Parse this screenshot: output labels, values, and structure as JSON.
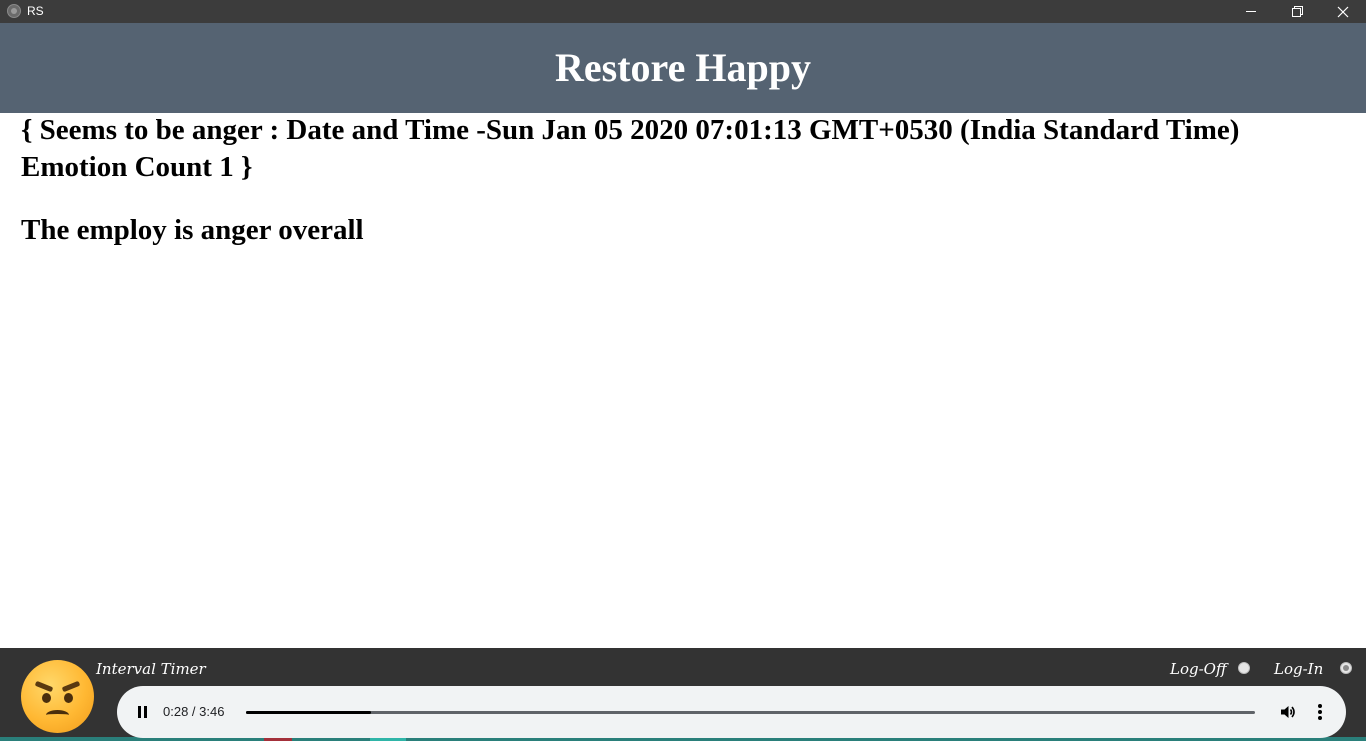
{
  "window": {
    "title": "RS",
    "icon": "app-logo-icon"
  },
  "header": {
    "title": "Restore Happy",
    "background_color": "#556372"
  },
  "main": {
    "status_text": "{ Seems to be anger : Date and Time -Sun Jan 05 2020 07:01:13 GMT+0530 (India Standard Time) Emotion Count 1 }",
    "summary_text": "The employ is anger overall"
  },
  "footer": {
    "emotion_icon": "angry-face-icon",
    "timer_label": "Interval Timer",
    "logoff_label": "Log-Off",
    "login_label": "Log-In",
    "selected_option": "Log-In"
  },
  "player": {
    "time_display": "0:28 / 3:46",
    "progress": 0.124,
    "state": "playing"
  }
}
